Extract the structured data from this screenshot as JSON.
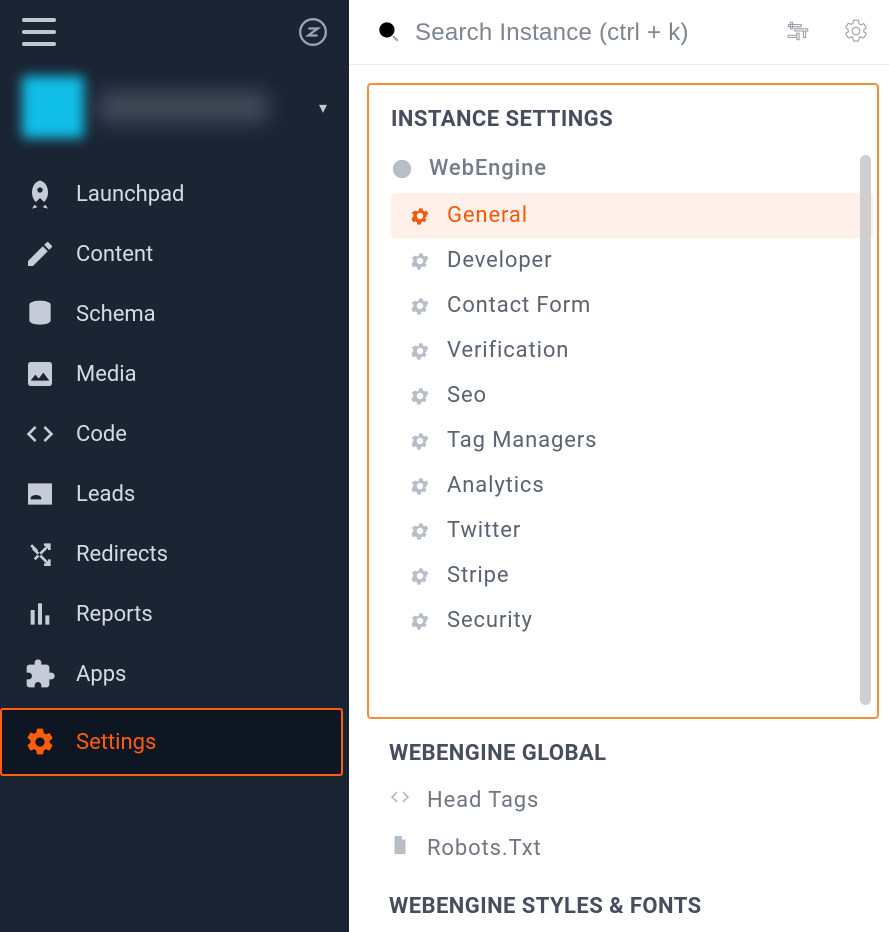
{
  "sidebar": {
    "items": [
      {
        "label": "Launchpad"
      },
      {
        "label": "Content"
      },
      {
        "label": "Schema"
      },
      {
        "label": "Media"
      },
      {
        "label": "Code"
      },
      {
        "label": "Leads"
      },
      {
        "label": "Redirects"
      },
      {
        "label": "Reports"
      },
      {
        "label": "Apps"
      },
      {
        "label": "Settings"
      }
    ]
  },
  "search": {
    "placeholder": "Search Instance (ctrl + k)"
  },
  "panel": {
    "title": "INSTANCE SETTINGS",
    "heading": "WebEngine",
    "items": [
      {
        "label": "General"
      },
      {
        "label": "Developer"
      },
      {
        "label": "Contact Form"
      },
      {
        "label": "Verification"
      },
      {
        "label": "Seo"
      },
      {
        "label": "Tag Managers"
      },
      {
        "label": "Analytics"
      },
      {
        "label": "Twitter"
      },
      {
        "label": "Stripe"
      },
      {
        "label": "Security"
      }
    ]
  },
  "sections": {
    "global_title": "WEBENGINE GLOBAL",
    "global_items": [
      {
        "label": "Head Tags"
      },
      {
        "label": "Robots.Txt"
      }
    ],
    "styles_title": "WEBENGINE STYLES & FONTS"
  }
}
